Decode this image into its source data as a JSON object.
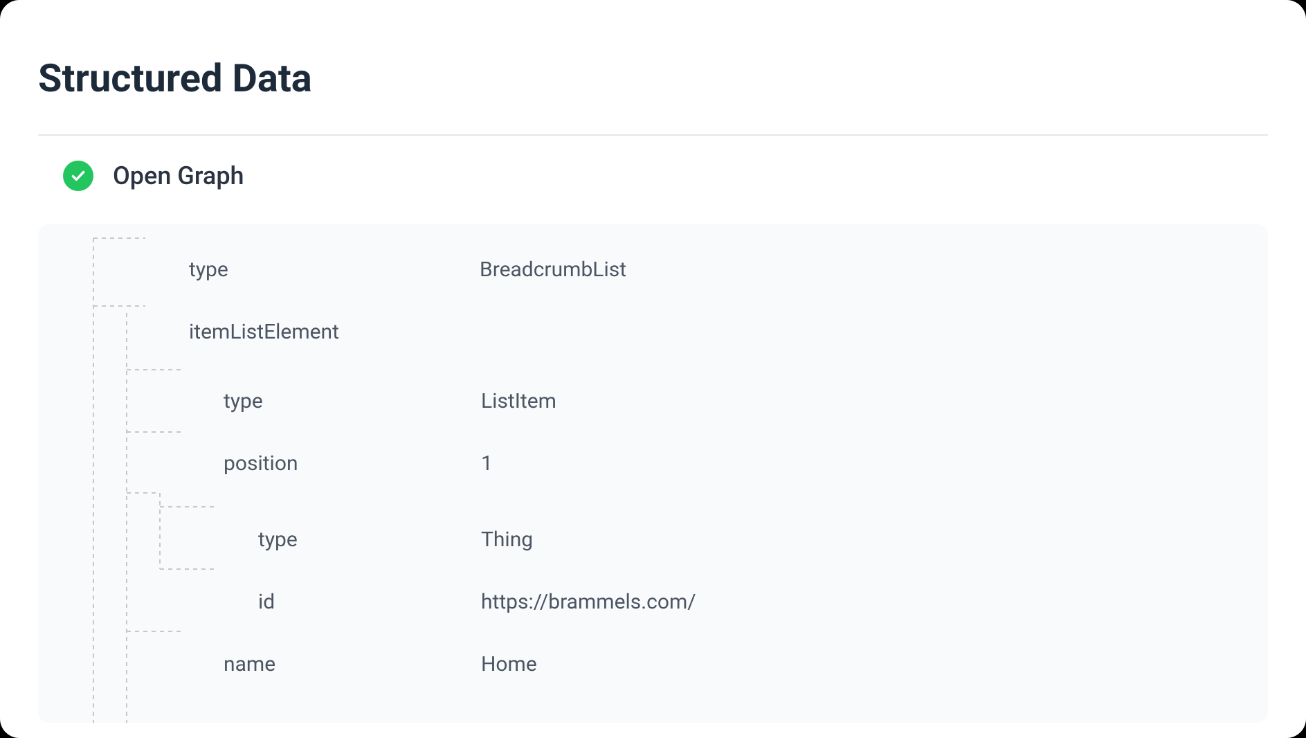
{
  "page": {
    "title": "Structured Data"
  },
  "section": {
    "status": "ok",
    "title": "Open Graph"
  },
  "tree": {
    "rows": [
      {
        "indent": 0,
        "key": "type",
        "value": "BreadcrumbList"
      },
      {
        "indent": 0,
        "key": "itemListElement",
        "value": ""
      },
      {
        "indent": 1,
        "key": "type",
        "value": "ListItem"
      },
      {
        "indent": 1,
        "key": "position",
        "value": "1"
      },
      {
        "indent": 2,
        "key": "type",
        "value": "Thing"
      },
      {
        "indent": 2,
        "key": "id",
        "value": "https://brammels.com/"
      },
      {
        "indent": 1,
        "key": "name",
        "value": "Home"
      }
    ]
  }
}
